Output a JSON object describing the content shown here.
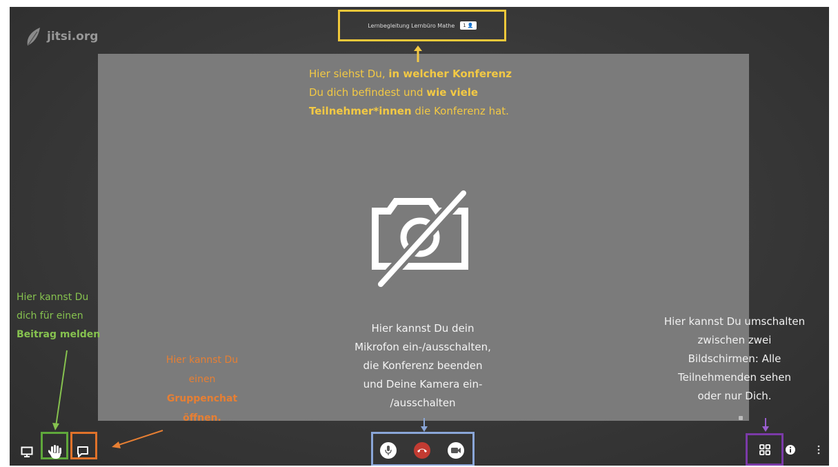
{
  "app": {
    "logo_text": "jitsi.org"
  },
  "header": {
    "conference_name": "Lernbegleitung Lernbüro Mathe",
    "participant_count": "1 👤"
  },
  "annotations": {
    "conference_info": [
      "Hier siehst Du, in welcher Konferenz",
      "Du dich befindest und wie viele",
      "Teilnehmer*innen die Konferenz hat."
    ],
    "raise_hand": [
      "Hier kannst Du",
      "dich für einen",
      "Beitrag melden"
    ],
    "chat": [
      "Hier kannst Du",
      "einen",
      "Gruppenchat",
      "öffnen."
    ],
    "av_controls": [
      "Hier kannst Du dein",
      "Mikrofon ein-/ausschalten,",
      "die Konferenz beenden",
      "und Deine Kamera ein-",
      "/ausschalten"
    ],
    "tile_view": [
      "Hier kannst Du umschalten",
      "zwischen zwei",
      "Bildschirmen: Alle",
      "Teilnehmenden sehen",
      "oder nur Dich."
    ]
  },
  "toolbar": {
    "left": [
      "screen-share-icon",
      "raise-hand-icon",
      "chat-icon"
    ],
    "center": [
      "microphone-icon",
      "hangup-icon",
      "camera-icon"
    ],
    "right": [
      "tile-view-icon",
      "info-icon",
      "more-icon"
    ]
  },
  "colors": {
    "conference_highlight": "#f0c83a",
    "raise_hand_highlight": "#5fa83b",
    "chat_highlight": "#e0722a",
    "controls_highlight": "#8aa6d8",
    "tile_view_highlight": "#7b3aa8",
    "hangup": "#c23b32"
  }
}
